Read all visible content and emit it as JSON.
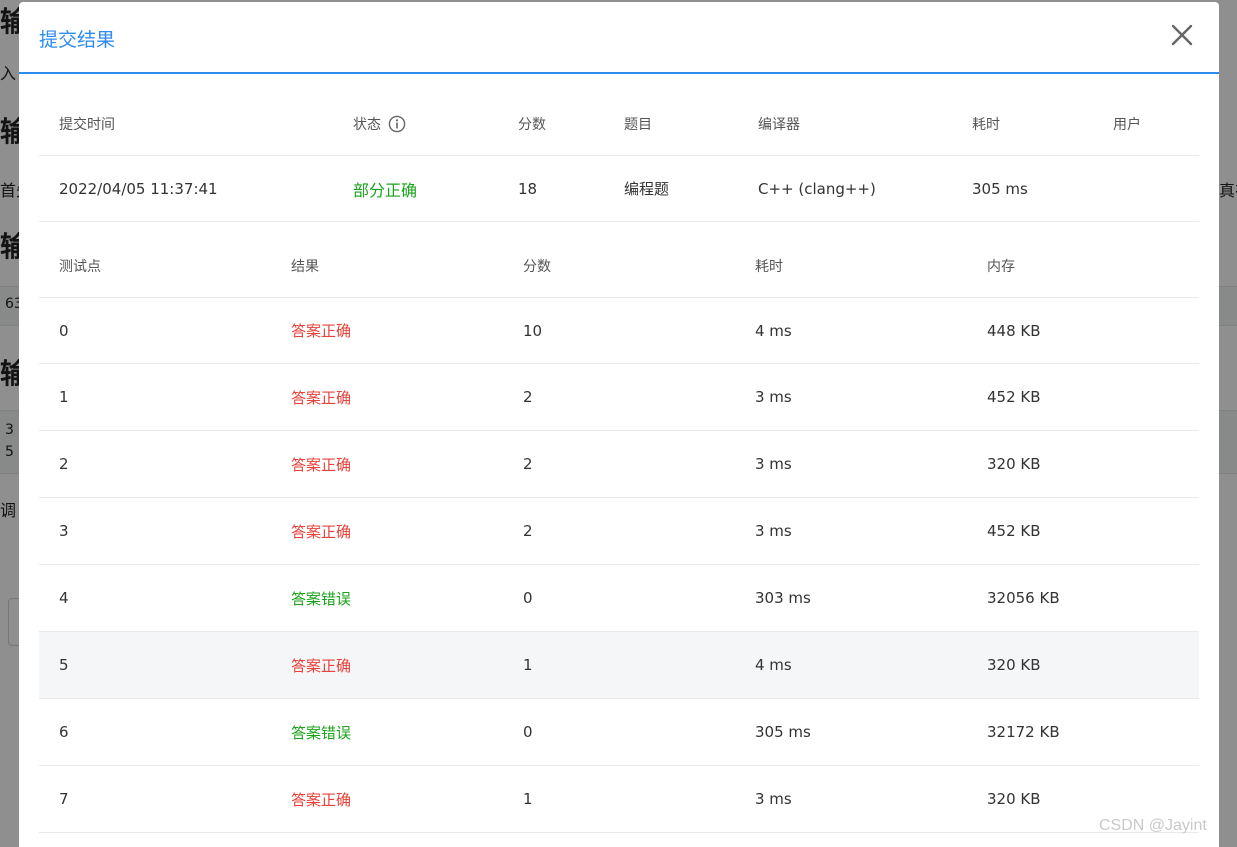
{
  "background": {
    "fragments": [
      "输",
      "入",
      "输",
      "首先",
      "输",
      "63",
      "输",
      "3",
      "5",
      "调",
      "真在"
    ]
  },
  "modal": {
    "title": "提交结果",
    "submission": {
      "headers": {
        "time": "提交时间",
        "status": "状态",
        "score": "分数",
        "problem": "题目",
        "compiler": "编译器",
        "elapsed": "耗时",
        "user": "用户"
      },
      "row": {
        "time": "2022/04/05 11:37:41",
        "status": "部分正确",
        "score": "18",
        "problem": "编程题",
        "compiler": "C++ (clang++)",
        "elapsed": "305 ms",
        "user": ""
      }
    },
    "tests": {
      "headers": {
        "case": "测试点",
        "result": "结果",
        "score": "分数",
        "time": "耗时",
        "memory": "内存"
      },
      "rows": [
        {
          "case": "0",
          "result": "答案正确",
          "score": "10",
          "time": "4 ms",
          "memory": "448 KB"
        },
        {
          "case": "1",
          "result": "答案正确",
          "score": "2",
          "time": "3 ms",
          "memory": "452 KB"
        },
        {
          "case": "2",
          "result": "答案正确",
          "score": "2",
          "time": "3 ms",
          "memory": "320 KB"
        },
        {
          "case": "3",
          "result": "答案正确",
          "score": "2",
          "time": "3 ms",
          "memory": "452 KB"
        },
        {
          "case": "4",
          "result": "答案错误",
          "score": "0",
          "time": "303 ms",
          "memory": "32056 KB"
        },
        {
          "case": "5",
          "result": "答案正确",
          "score": "1",
          "time": "4 ms",
          "memory": "320 KB"
        },
        {
          "case": "6",
          "result": "答案错误",
          "score": "0",
          "time": "305 ms",
          "memory": "32172 KB"
        },
        {
          "case": "7",
          "result": "答案正确",
          "score": "1",
          "time": "3 ms",
          "memory": "320 KB"
        }
      ]
    }
  },
  "watermark": "CSDN @Jayint",
  "colors": {
    "accent": "#2d8cf0",
    "correct": "#e8413a",
    "wrong": "#19a31b",
    "partial": "#19a31b",
    "highlight_row": "#f5f6f8"
  },
  "icons": {
    "close": "close-icon",
    "status_info": "info-circle-icon"
  }
}
